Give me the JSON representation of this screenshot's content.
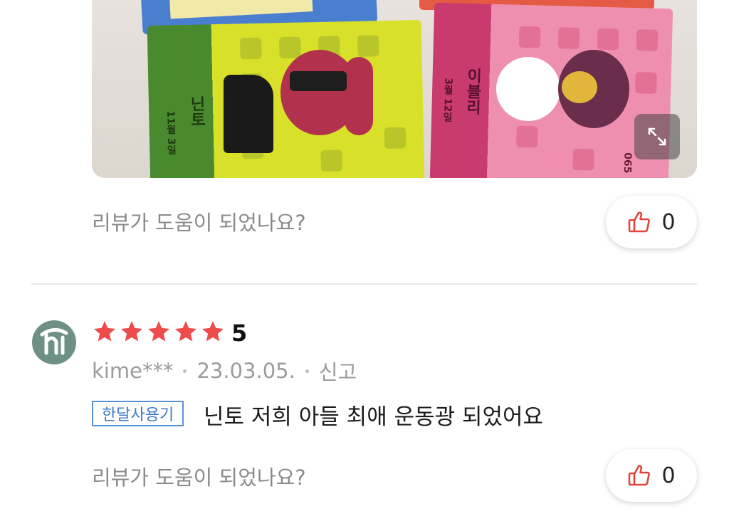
{
  "photo": {
    "card_left_name": "닌토",
    "card_left_date": "11월 3일",
    "card_right_name": "이블리",
    "card_right_date": "3월 12일",
    "card_right_number": "065"
  },
  "review1": {
    "helpful_question": "리뷰가 도움이 되었나요?",
    "like_count": "0"
  },
  "review2": {
    "rating_value": "5",
    "rating_stars": 5,
    "author": "kime***",
    "date": "23.03.05.",
    "report_label": "신고",
    "tag_label": "한달사용기",
    "body": "닌토 저희 아들 최애 운동광 되었어요",
    "helpful_question": "리뷰가 도움이 되었나요?",
    "like_count": "0"
  },
  "colors": {
    "star": "#ee4b4b",
    "thumb": "#e0453c",
    "tag": "#3f78c9",
    "avatar": "#6f9085"
  },
  "icons": [
    "expand-icon",
    "thumbs-up-icon",
    "star-icon",
    "avatar-logo-icon"
  ]
}
